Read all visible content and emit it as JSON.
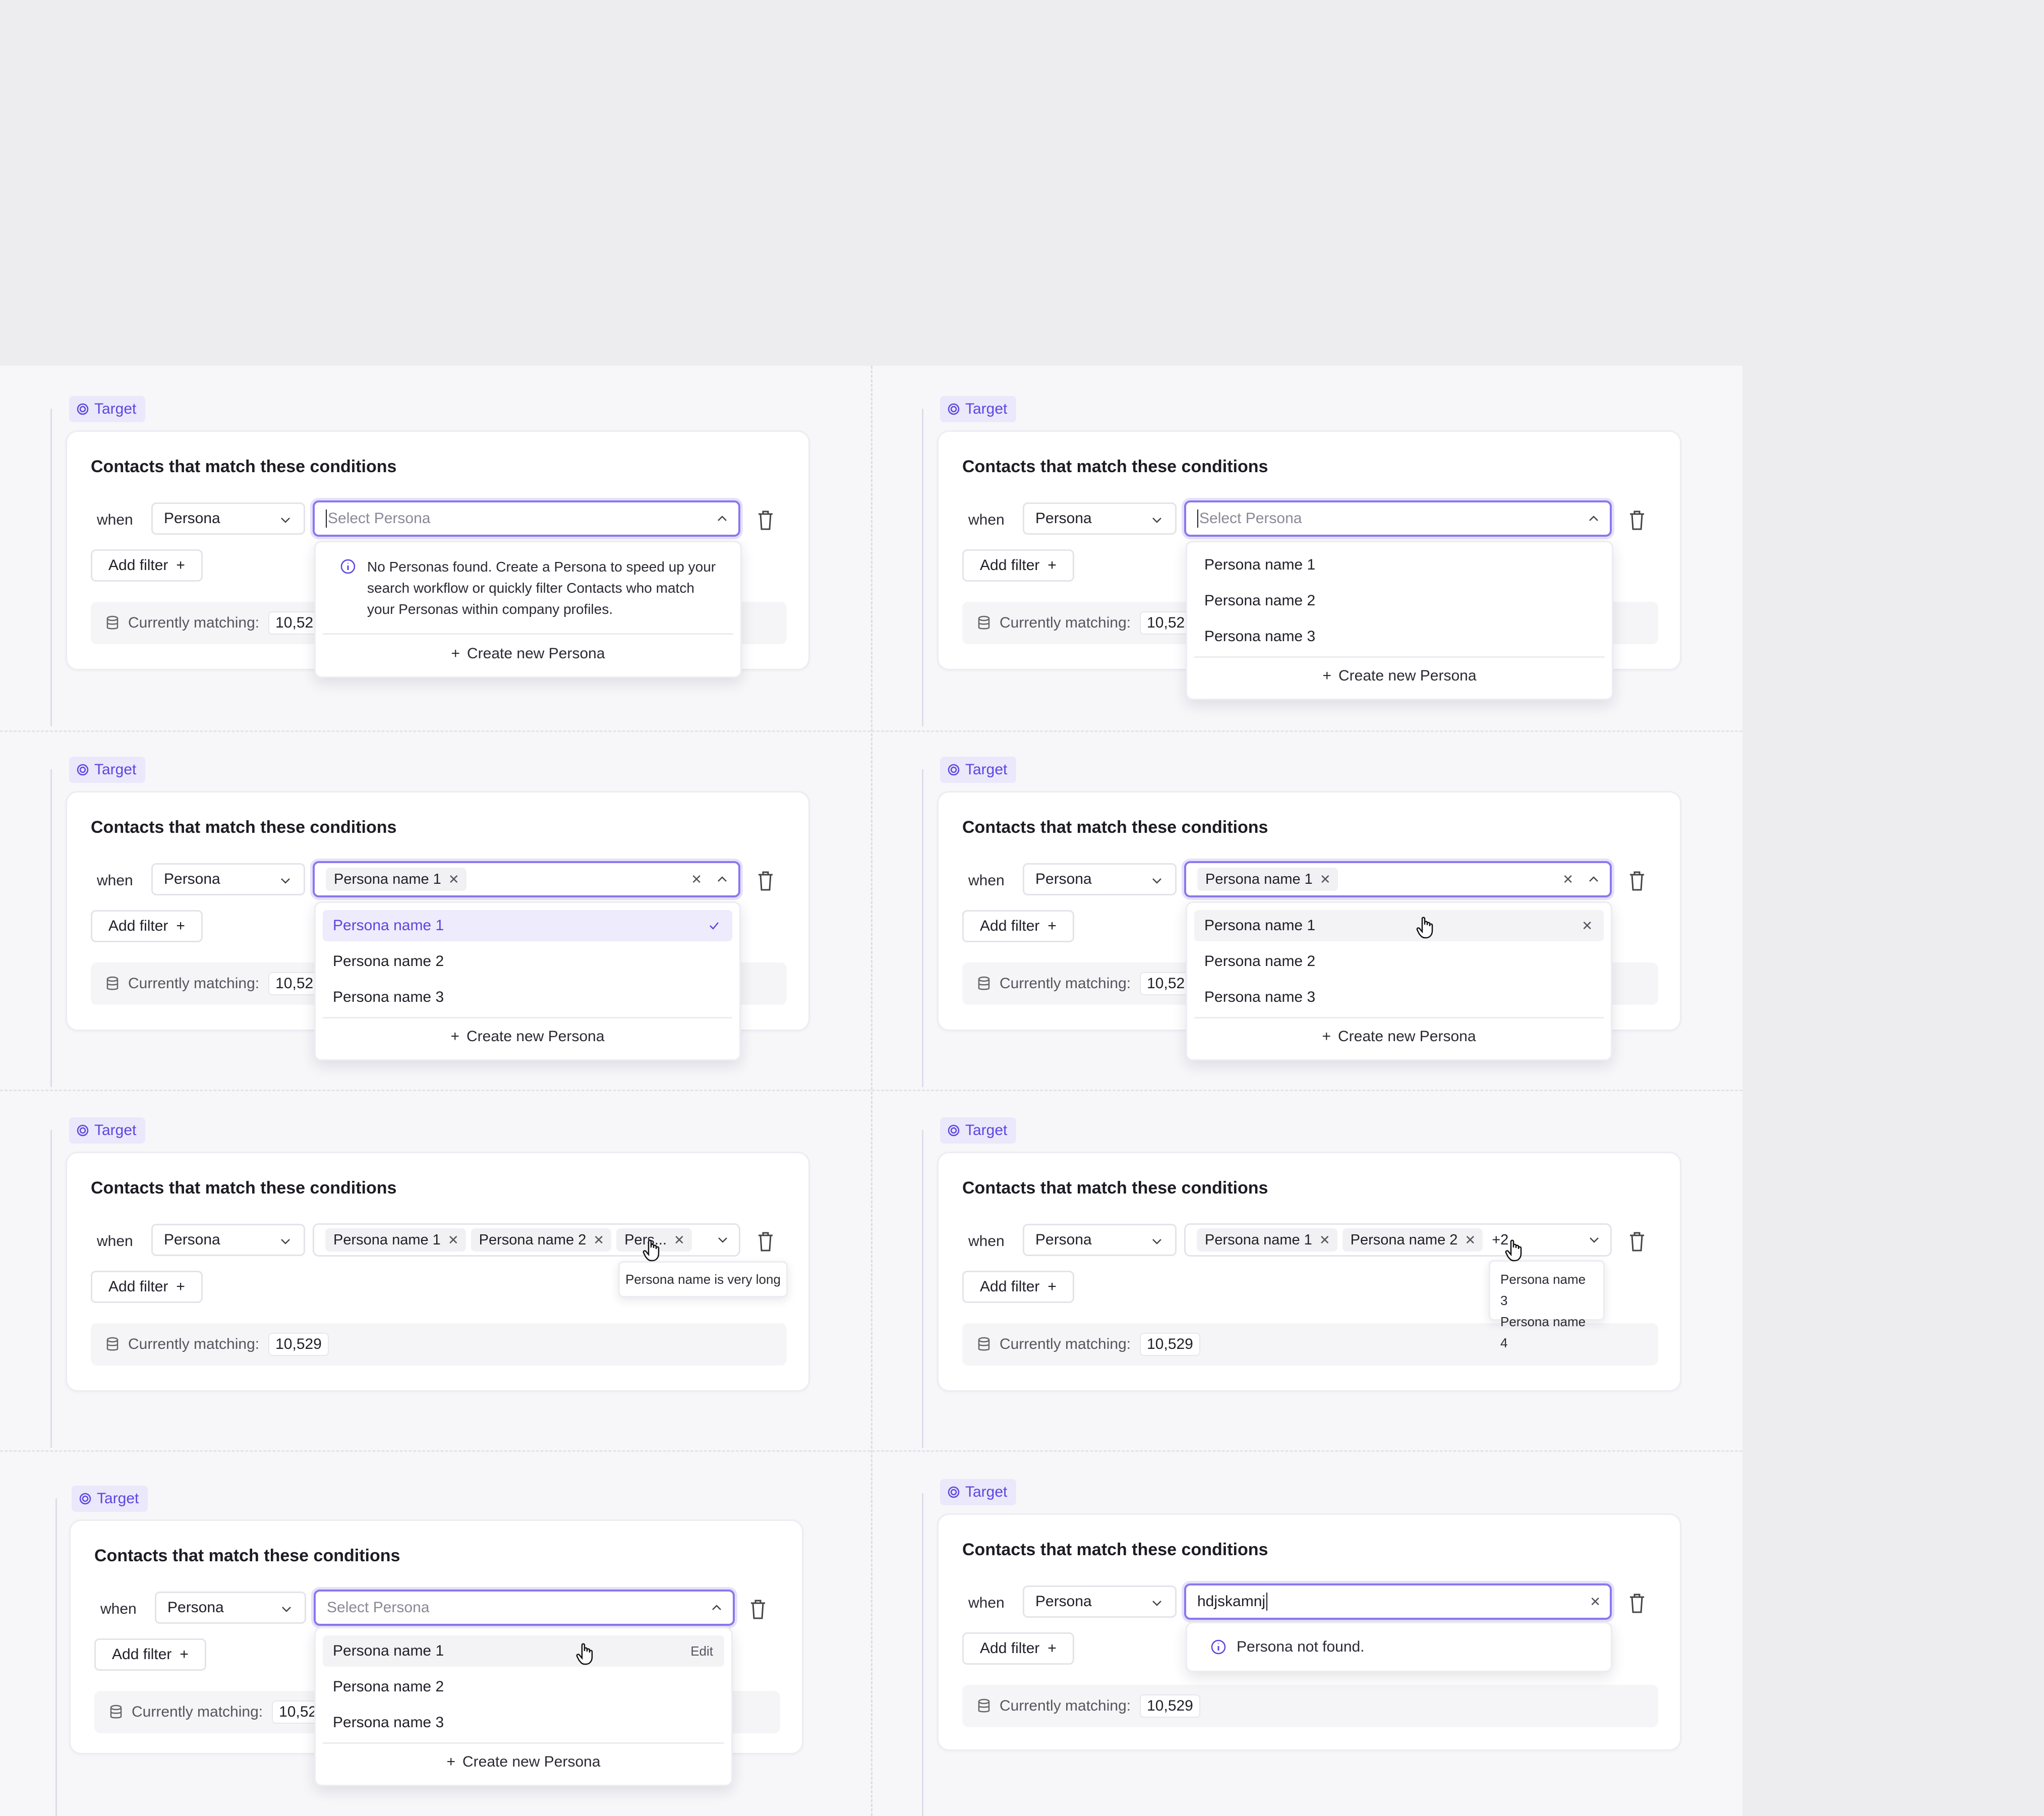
{
  "common": {
    "target_label": "Target",
    "card_title": "Contacts that match these conditions",
    "when_label": "when",
    "field_value": "Persona",
    "add_filter_label": "Add filter",
    "matching_label": "Currently matching:",
    "matching_value": "10,529",
    "matching_value_clipped": "10,52",
    "placeholder": "Select Persona",
    "create_label": "Create new Persona",
    "options": [
      "Persona name 1",
      "Persona name 2",
      "Persona name 3"
    ]
  },
  "state_empty": {
    "message": "No Personas found. Create a Persona to speed up your search workflow or quickly filter Contacts who match your Personas within company profiles."
  },
  "state_multi": {
    "chips": [
      "Persona name 1",
      "Persona name 2",
      "Pers..."
    ],
    "tooltip": "Persona name is very long"
  },
  "state_overflow": {
    "chips": [
      "Persona name 1",
      "Persona name 2"
    ],
    "more": "+2",
    "hidden": [
      "Persona name 3",
      "Persona name 4"
    ]
  },
  "state_edit": {
    "edit_label": "Edit"
  },
  "state_search": {
    "query": "hdjskamnj",
    "not_found": "Persona not found."
  },
  "colors": {
    "accent": "#5b46e0",
    "focus_border": "#8b78ee"
  }
}
